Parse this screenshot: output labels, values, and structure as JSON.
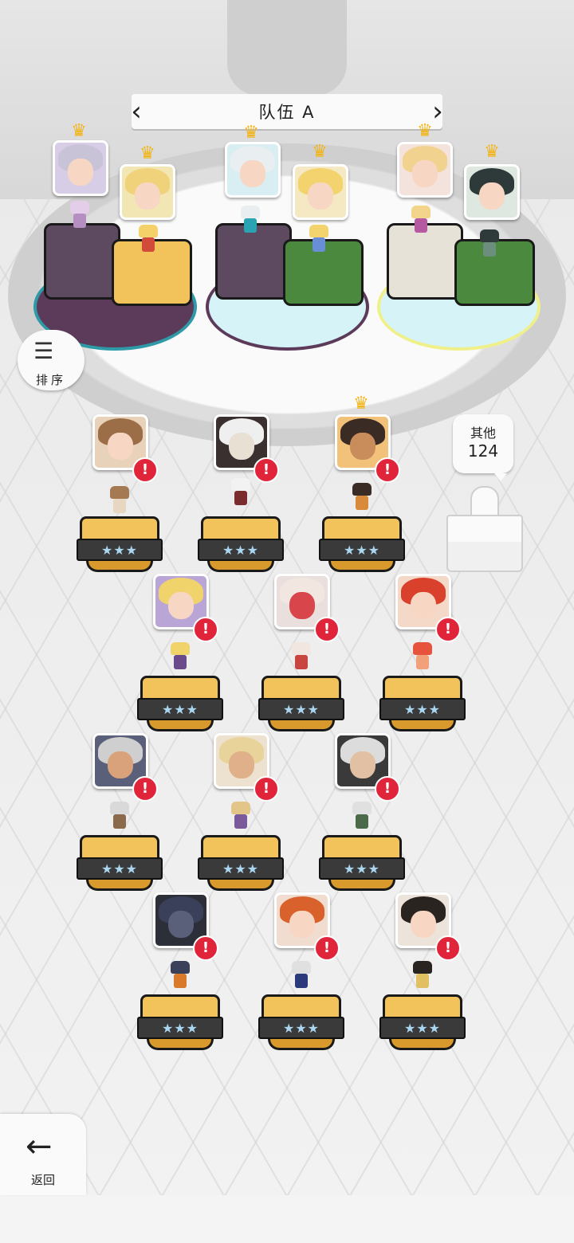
{
  "team": {
    "title": "队伍 A",
    "prev_icon": "chevron-left-icon",
    "next_icon": "chevron-right-icon"
  },
  "sort_button": {
    "label": "排序",
    "icon": "sort-list-icon"
  },
  "others": {
    "label": "其他",
    "count": "124"
  },
  "back_button": {
    "label": "返回",
    "icon": "arrow-left-icon"
  },
  "colors": {
    "crown": "#f2b416",
    "alert": "#e0243a",
    "pedestal_gold": "#f2c35a",
    "star_blue": "#a9d6f0"
  },
  "roster": {
    "stars": "★★★",
    "alert_mark": "!"
  }
}
